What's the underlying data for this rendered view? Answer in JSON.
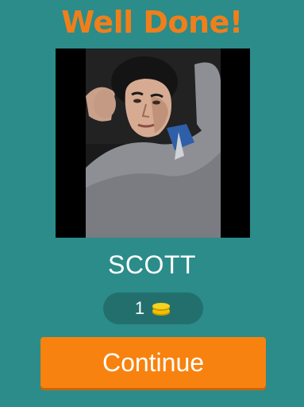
{
  "header": {
    "title": "Well Done!"
  },
  "puzzle": {
    "image": "portrait-photo",
    "answer": "SCOTT"
  },
  "reward": {
    "coins": "1",
    "icon": "coin-stack-icon"
  },
  "actions": {
    "continue_label": "Continue"
  },
  "colors": {
    "background": "#2b8c8a",
    "title": "#f07f1a",
    "button": "#f7820f",
    "coin_pill": "#236f6d",
    "coin": "#f2c200"
  }
}
